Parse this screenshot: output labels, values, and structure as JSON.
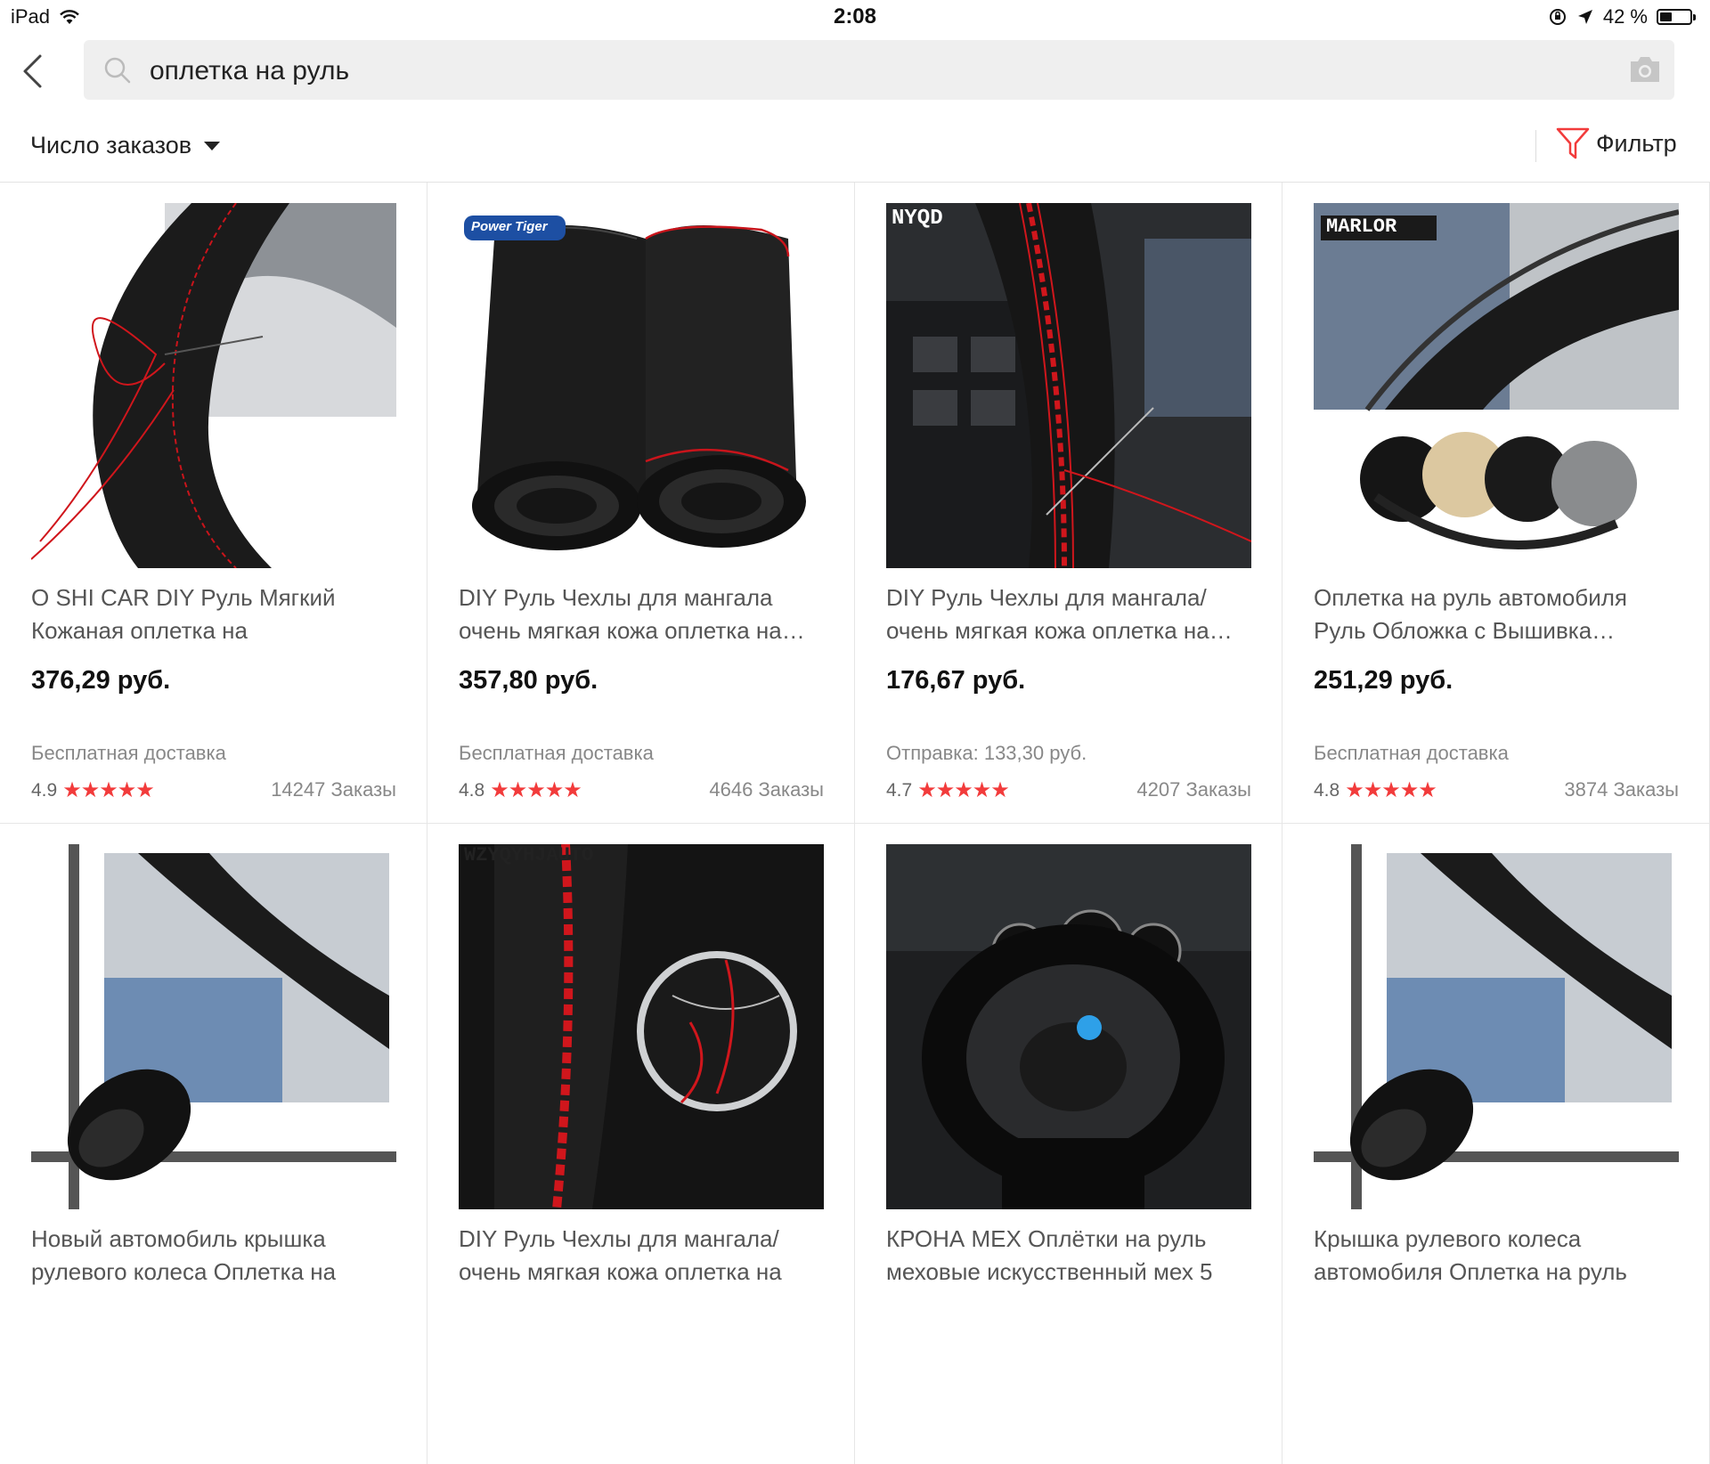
{
  "status_bar": {
    "device": "iPad",
    "time": "2:08",
    "battery": "42 %",
    "battery_level": 0.42
  },
  "search": {
    "query": "оплетка на руль"
  },
  "sortbar": {
    "sort_label": "Число заказов",
    "filter_label": "Фильтр"
  },
  "products": [
    {
      "title": "O SHI CAR DIY Руль Мягкий Кожаная оплетка на",
      "price": "376,29 руб.",
      "shipping": "Бесплатная доставка",
      "rating": "4.9",
      "stars": "★★★★★",
      "orders": "14247 Заказы",
      "image_label": ""
    },
    {
      "title": "DIY Руль Чехлы для мангала очень мягкая кожа оплетка на…",
      "price": "357,80 руб.",
      "shipping": "Бесплатная доставка",
      "rating": "4.8",
      "stars": "★★★★★",
      "orders": "4646 Заказы",
      "image_label": "Power Tiger"
    },
    {
      "title": "DIY Руль Чехлы для мангала/ очень мягкая кожа оплетка на…",
      "price": "176,67 руб.",
      "shipping": "Отправка: 133,30 руб.",
      "rating": "4.7",
      "stars": "★★★★★",
      "orders": "4207 Заказы",
      "image_label": "NYQD"
    },
    {
      "title": "Оплетка на руль автомобиля Руль Обложка с Вышивка…",
      "price": "251,29 руб.",
      "shipping": "Бесплатная доставка",
      "rating": "4.8",
      "stars": "★★★★★",
      "orders": "3874 Заказы",
      "image_label": "MARLOR"
    },
    {
      "title": "Новый автомобиль крышка рулевого колеса Оплетка на",
      "price": "",
      "shipping": "",
      "rating": "",
      "stars": "",
      "orders": "",
      "image_label": ""
    },
    {
      "title": "DIY Руль Чехлы для мангала/ очень мягкая кожа оплетка на",
      "price": "",
      "shipping": "",
      "rating": "",
      "stars": "",
      "orders": "",
      "image_label": "WZYQYHJAUTO"
    },
    {
      "title": "КРОНА МЕХ Оплётки на руль меховые искусственный мех 5",
      "price": "",
      "shipping": "",
      "rating": "",
      "stars": "",
      "orders": "",
      "image_label": ""
    },
    {
      "title": "Крышка рулевого колеса автомобиля Оплетка на руль",
      "price": "",
      "shipping": "",
      "rating": "",
      "stars": "",
      "orders": "",
      "image_label": ""
    }
  ],
  "colors": {
    "accent": "#f23b3b",
    "search_bg": "#efefef",
    "divider": "#e6e6e6"
  }
}
